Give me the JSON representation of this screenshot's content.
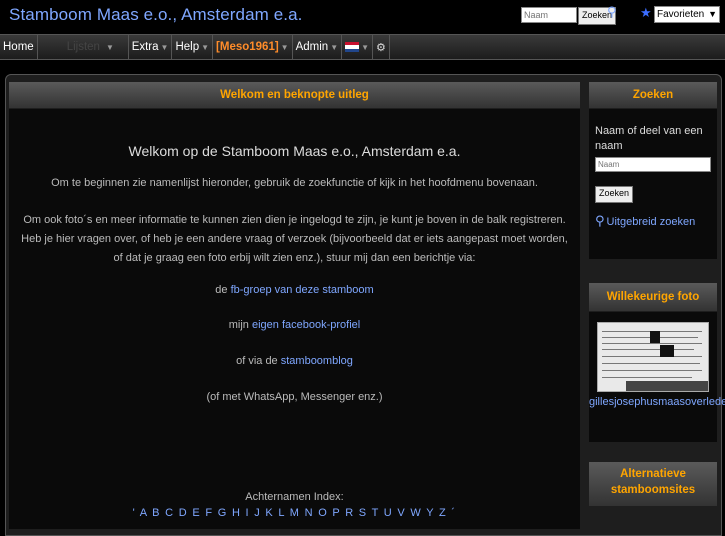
{
  "header": {
    "title": "Stamboom Maas e.o., Amsterdam e.a.",
    "search_placeholder": "Naam",
    "search_button": "Zoeken",
    "favorites_select": "Favorieten lijst"
  },
  "menu": {
    "home": "Home",
    "dim_item": "Lijsten",
    "extra": "Extra",
    "help": "Help",
    "user": "[Meso1961]",
    "admin": "Admin"
  },
  "content": {
    "header": "Welkom en beknopte uitleg",
    "welcome": "Welkom op de Stamboom Maas e.o., Amsterdam e.a.",
    "intro": "Om te beginnen zie namenlijst hieronder, gebruik de zoekfunctie of kijk in het hoofdmenu bovenaan.",
    "info": "Om ook foto´s en meer informatie te kunnen zien dien je ingelogd te zijn, je kunt je boven in de balk registreren. Heb je hier vragen over, of heb je een andere vraag of verzoek (bijvoorbeeld dat er iets aangepast moet worden, of dat je graag een foto erbij wilt zien enz.), stuur mij dan een berichtje via:",
    "fb_group_prefix": "de ",
    "fb_group_link": "fb-groep van deze stamboom",
    "fb_profile_prefix": "mijn ",
    "fb_profile_link": "eigen facebook-profiel",
    "blog_prefix": "of via de ",
    "blog_link": "stamboomblog",
    "whatsapp": "(of met WhatsApp, Messenger enz.)",
    "index_label": "Achternamen Index:",
    "alphabet": "' A B C D E F G H I J K L M N O P R S T U V W Y Z ´"
  },
  "sidebar": {
    "search_header": "Zoeken",
    "search_label": "Naam of deel van een naam",
    "search_placeholder": "Naam",
    "search_button": "Zoeken",
    "advanced_search": "Uitgebreid zoeken",
    "photo_header": "Willekeurige foto",
    "photo_caption": "gillesjosephusmaasoverleden",
    "alt_header": "Alternatieve stamboomsites"
  },
  "colors": {
    "accent_orange": "#ffa500",
    "link_blue": "#7fa7ff",
    "title_blue": "#7fa7ff"
  }
}
